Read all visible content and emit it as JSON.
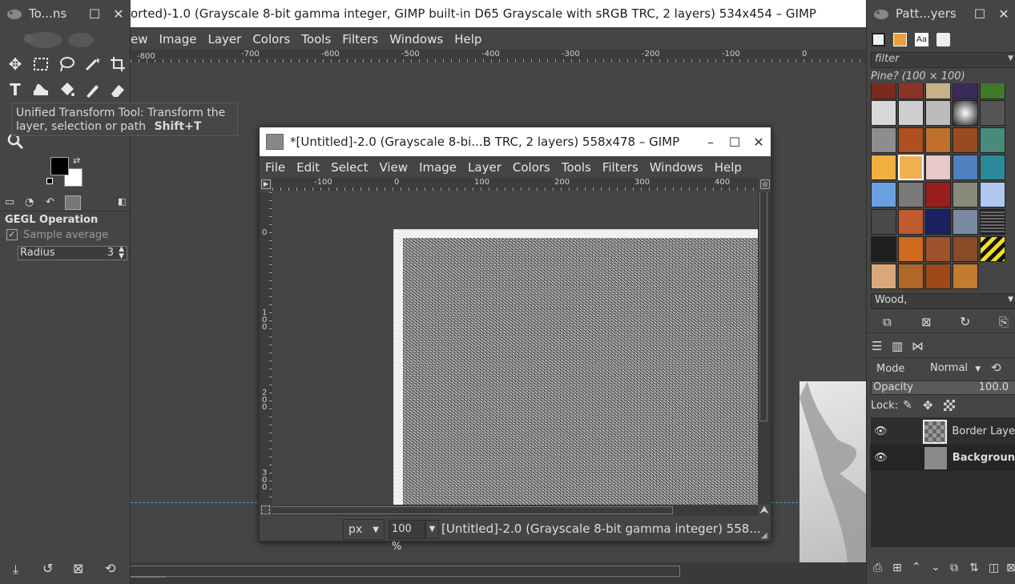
{
  "main_window": {
    "title": "orted)-1.0 (Grayscale 8-bit gamma integer, GIMP built-in D65 Grayscale with sRGB TRC, 2 layers) 534x454 – GIMP",
    "menu": [
      "ew",
      "Image",
      "Layer",
      "Colors",
      "Tools",
      "Filters",
      "Windows",
      "Help"
    ],
    "ruler_labels": [
      "-800",
      "-700",
      "-600",
      "-500",
      "-400",
      "-300",
      "-200",
      "-100",
      "0"
    ]
  },
  "toolbox": {
    "title": "To...ns",
    "tooltip": {
      "text": "Unified Transform Tool: Transform the layer, selection or path",
      "shortcut": "Shift+T"
    },
    "options_title": "GEGL Operation",
    "sample_average_label": "Sample average",
    "radius_label": "Radius",
    "radius_value": "3",
    "fg_color": "#000000",
    "bg_color": "#ffffff"
  },
  "image_window": {
    "title": "*[Untitled]-2.0 (Grayscale 8-bi...B TRC, 2 layers) 558x478 – GIMP",
    "menu": [
      "File",
      "Edit",
      "Select",
      "View",
      "Image",
      "Layer",
      "Colors",
      "Tools",
      "Filters",
      "Windows",
      "Help"
    ],
    "ruler_labels": [
      "-100",
      "0",
      "100",
      "200",
      "300",
      "400"
    ],
    "vruler_labels": [
      "0",
      "1\n0\n0",
      "2\n0\n0",
      "3\n0\n0"
    ],
    "unit": "px",
    "zoom": "100 %",
    "status": "[Untitled]-2.0 (Grayscale 8-bit gamma integer) 558..."
  },
  "patterns_panel": {
    "title": "Patt...yers",
    "filter_placeholder": "filter",
    "selected_pattern": "Pine? (100 × 100)",
    "tag_value": "Wood,"
  },
  "layers_panel": {
    "mode_label": "Mode",
    "mode_value": "Normal",
    "opacity_label": "Opacity",
    "opacity_value": "100.0",
    "lock_label": "Lock:",
    "layers": [
      {
        "name": "Border Laye",
        "bold": false
      },
      {
        "name": "Backgroun",
        "bold": true
      }
    ]
  }
}
